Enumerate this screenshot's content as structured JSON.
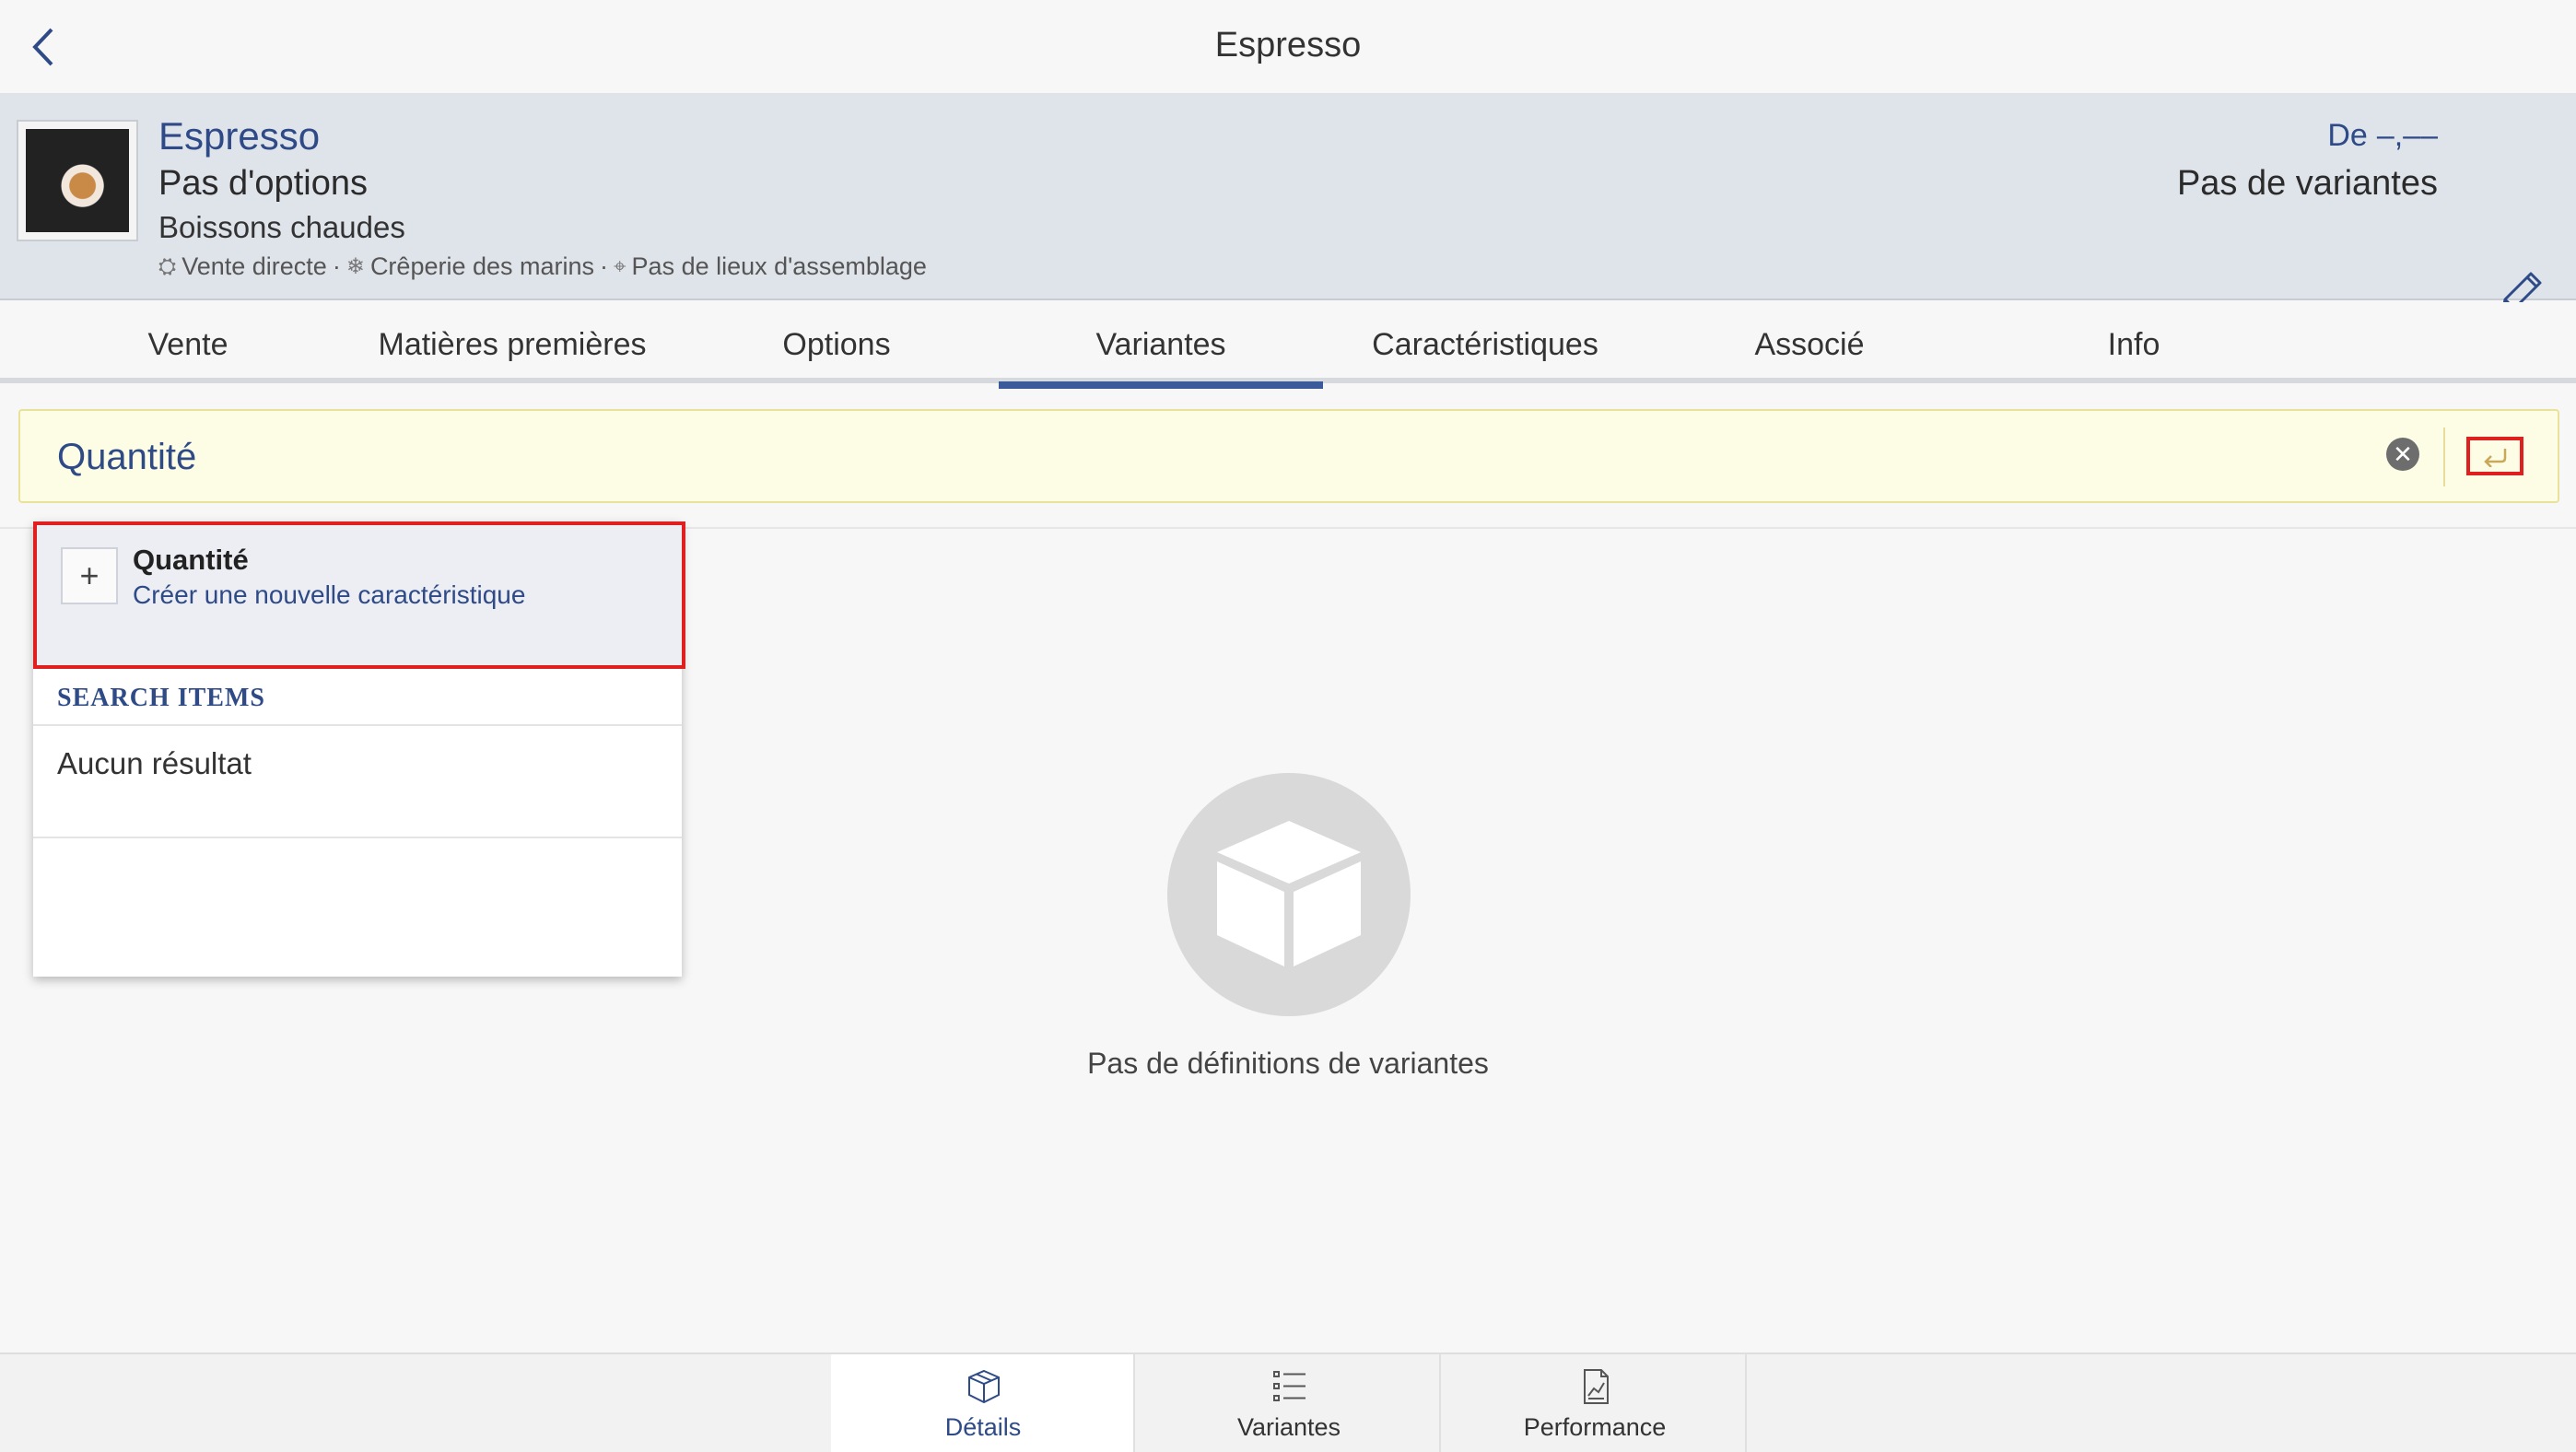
{
  "topbar": {
    "title": "Espresso",
    "back_icon": "chevron-left-icon"
  },
  "product": {
    "name": "Espresso",
    "options": "Pas d'options",
    "category": "Boissons chaudes",
    "meta": {
      "direct_sale": "Vente directe",
      "separator1": "·",
      "location": "Crêperie des marins",
      "separator2": "·",
      "assembly": "Pas de lieux d'assemblage"
    },
    "price_prefix": "De",
    "price_value": "–,––",
    "variants_state": "Pas de variantes"
  },
  "tabs": [
    {
      "label": "Vente"
    },
    {
      "label": "Matières premières"
    },
    {
      "label": "Options"
    },
    {
      "label": "Variantes"
    },
    {
      "label": "Caractéristiques"
    },
    {
      "label": "Associé"
    },
    {
      "label": "Info"
    }
  ],
  "active_tab": "Variantes",
  "search": {
    "value": "Quantité"
  },
  "dropdown": {
    "create_title": "Quantité",
    "create_subtitle": "Créer une nouvelle caractéristique",
    "section_header": "SEARCH ITEMS",
    "no_results": "Aucun résultat"
  },
  "empty_state": {
    "text": "Pas de définitions de variantes"
  },
  "bottom_tabs": [
    {
      "label": "Détails",
      "icon": "box-icon"
    },
    {
      "label": "Variantes",
      "icon": "list-icon"
    },
    {
      "label": "Performance",
      "icon": "chart-doc-icon"
    }
  ],
  "colors": {
    "accent": "#2e4a87",
    "highlight_border": "#e02020",
    "search_bg": "#fdfde5",
    "header_bg": "#dfe3ea"
  }
}
